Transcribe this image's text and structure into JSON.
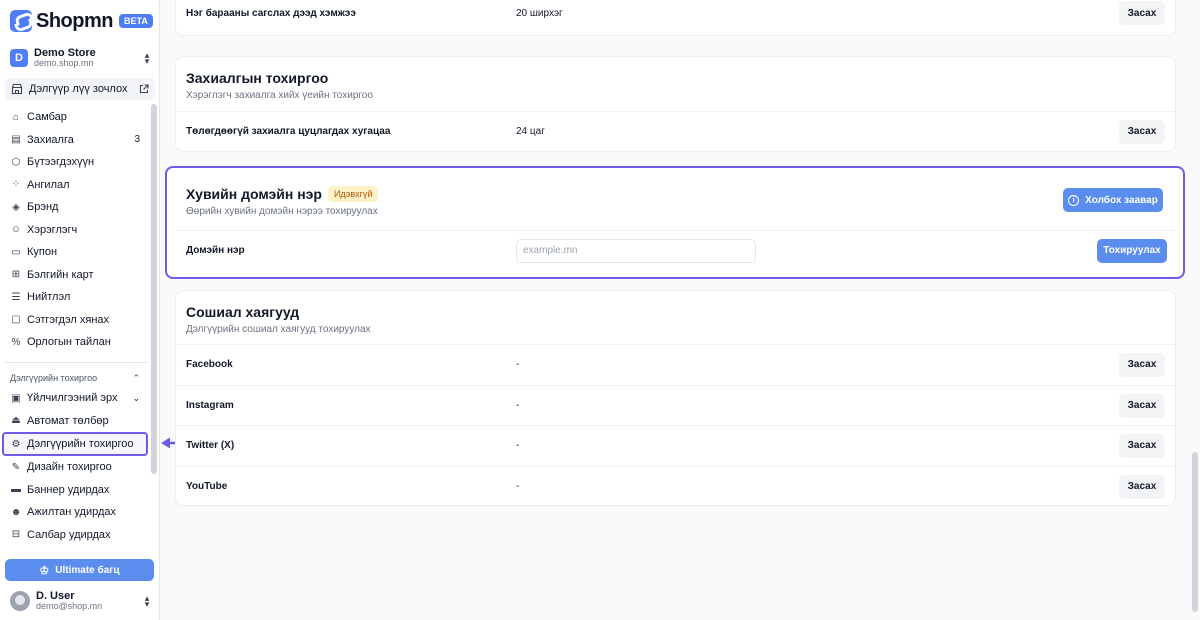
{
  "brand": {
    "name": "Shopmn",
    "badge": "BETA"
  },
  "store": {
    "initial": "D",
    "name": "Demo Store",
    "domain": "demo.shop.mn"
  },
  "visit_store": {
    "label": "Дэлгүүр лүү зочлох"
  },
  "nav": {
    "items": [
      {
        "label": "Самбар",
        "icon": "home-icon"
      },
      {
        "label": "Захиалга",
        "icon": "orders-icon",
        "count": "3"
      },
      {
        "label": "Бүтээгдэхүүн",
        "icon": "box-icon"
      },
      {
        "label": "Ангилал",
        "icon": "category-icon"
      },
      {
        "label": "Брэнд",
        "icon": "tag-icon"
      },
      {
        "label": "Хэрэглэгч",
        "icon": "users-icon"
      },
      {
        "label": "Купон",
        "icon": "ticket-icon"
      },
      {
        "label": "Бэлгийн карт",
        "icon": "gift-icon"
      },
      {
        "label": "Нийтлэл",
        "icon": "article-icon"
      },
      {
        "label": "Сэтгэгдэл хянах",
        "icon": "comment-icon"
      },
      {
        "label": "Орлогын тайлан",
        "icon": "report-icon"
      }
    ],
    "section_title": "Дэлгүүрийн тохиргоо",
    "settings_items": [
      {
        "label": "Үйлчилгээний эрх",
        "icon": "subscription-icon"
      },
      {
        "label": "Автомат төлбөр",
        "icon": "bank-icon"
      },
      {
        "label": "Дэлгүүрийн тохиргоо",
        "icon": "settings-icon"
      },
      {
        "label": "Дизайн тохиргоо",
        "icon": "brush-icon"
      },
      {
        "label": "Баннер удирдах",
        "icon": "banner-icon"
      },
      {
        "label": "Ажилтан удирдах",
        "icon": "staff-icon"
      },
      {
        "label": "Салбар удирдах",
        "icon": "branch-icon"
      }
    ]
  },
  "upgrade": {
    "label": "Ultimate багц"
  },
  "user": {
    "name": "D. User",
    "email": "demo@shop.mn"
  },
  "cart_card": {
    "row_label": "Нэг барааны сагслах дээд хэмжээ",
    "row_value": "20 ширхэг",
    "edit_label": "Засах"
  },
  "order_card": {
    "title": "Захиалгын тохиргоо",
    "subtitle": "Хэрэглэгч захиалга хийх үеийн тохиргоо",
    "row_label": "Төлөгдөөгүй захиалга цуцлагдах хугацаа",
    "row_value": "24 цаг",
    "edit_label": "Засах"
  },
  "domain_card": {
    "title": "Хувийн домэйн нэр",
    "badge": "Идэвхгүй",
    "subtitle": "Өөрийн хувийн домэйн нэрээ тохируулах",
    "guide_label": "Холбох заавар",
    "row_label": "Домэйн нэр",
    "input_placeholder": "example.mn",
    "apply_label": "Тохируулах"
  },
  "social_card": {
    "title": "Сошиал хаягууд",
    "subtitle": "Дэлгүүрийн сошиал хаягууд тохируулах",
    "edit_label": "Засах",
    "rows": [
      {
        "label": "Facebook",
        "value": "-"
      },
      {
        "label": "Instagram",
        "value": "-"
      },
      {
        "label": "Twitter (X)",
        "value": "-"
      },
      {
        "label": "YouTube",
        "value": "-"
      }
    ]
  }
}
